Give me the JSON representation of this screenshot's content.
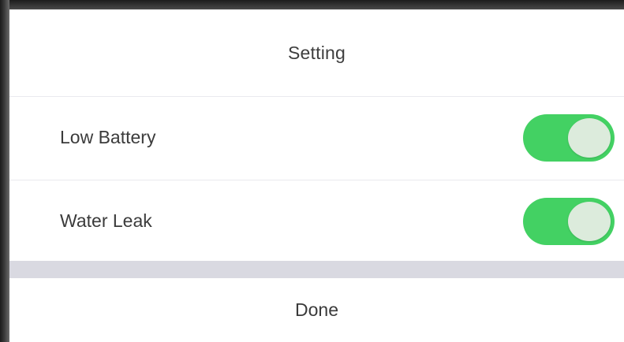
{
  "dialog": {
    "title": "Setting",
    "settings": [
      {
        "label": "Low Battery",
        "enabled": true
      },
      {
        "label": "Water Leak",
        "enabled": true
      }
    ],
    "done_label": "Done"
  },
  "colors": {
    "toggle_on": "#43d163",
    "toggle_knob": "#dcebdc",
    "separator_band": "#d9d9e1"
  }
}
